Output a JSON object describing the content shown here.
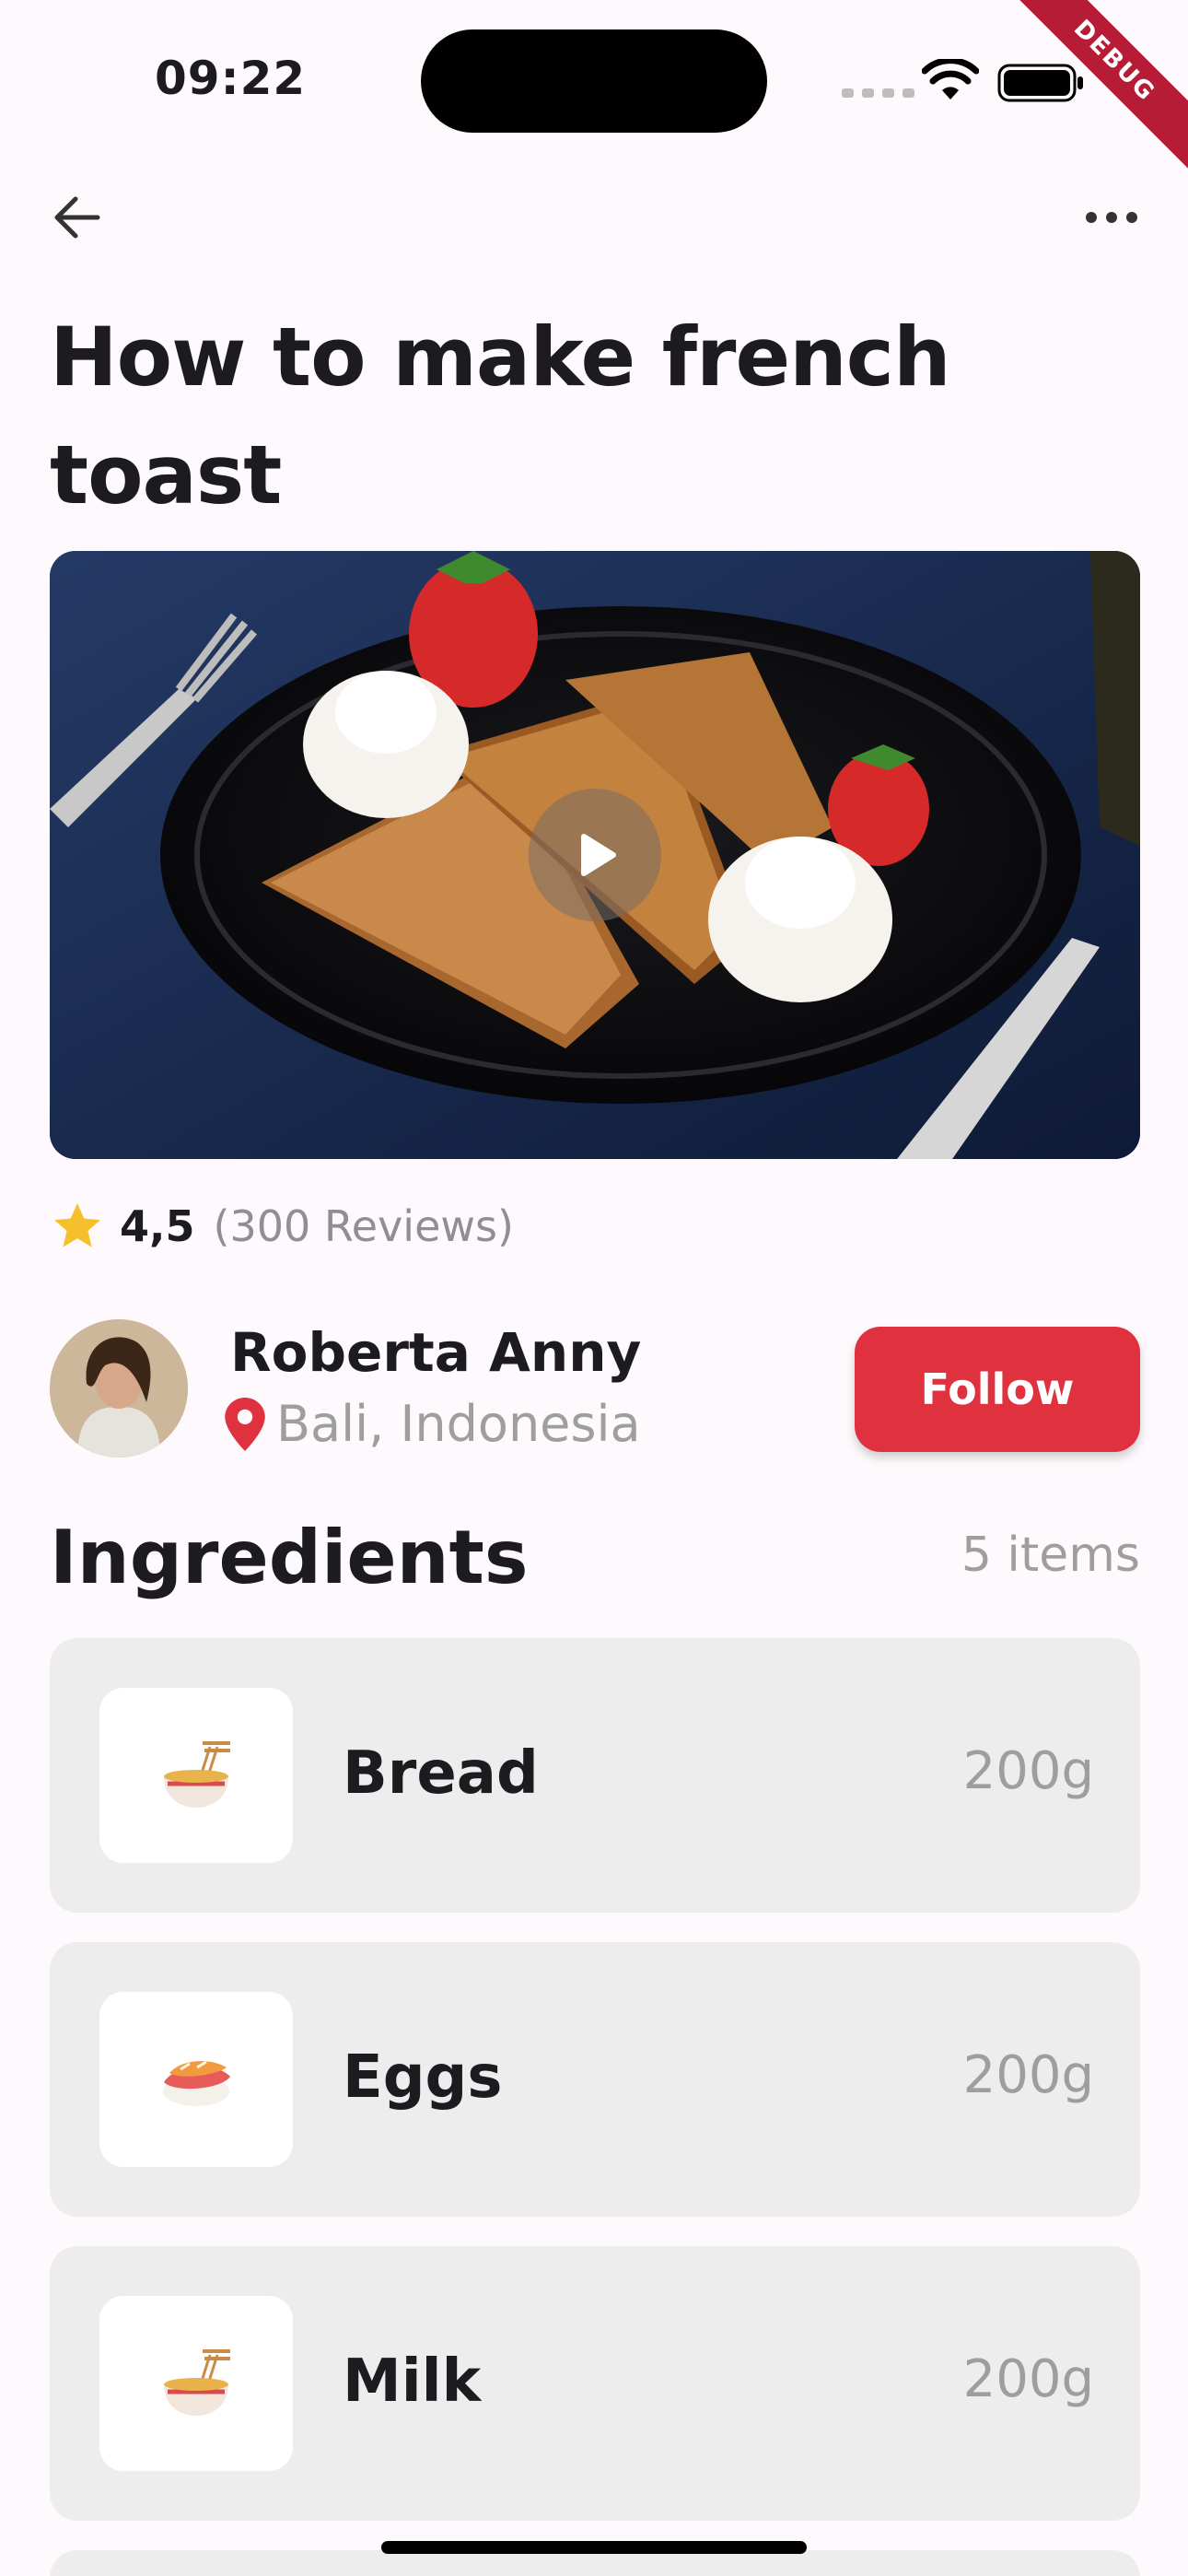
{
  "status_bar": {
    "time": "09:22",
    "debug_label": "DEBUG"
  },
  "header": {
    "back_icon": "arrow-left-icon",
    "more_icon": "more-horizontal-icon"
  },
  "recipe": {
    "title": "How to make french toast",
    "video_icon": "play-icon"
  },
  "rating": {
    "value": "4,5",
    "reviews": "(300 Reviews)",
    "star_color": "#f6c02c"
  },
  "author": {
    "name": "Roberta Anny",
    "location": "Bali, Indonesia",
    "follow_label": "Follow",
    "accent_color": "#e0313f"
  },
  "ingredients": {
    "title": "Ingredients",
    "count": "5 items",
    "items": [
      {
        "name": "Bread",
        "qty": "200g",
        "icon": "noodle-bowl-icon"
      },
      {
        "name": "Eggs",
        "qty": "200g",
        "icon": "sushi-icon"
      },
      {
        "name": "Milk",
        "qty": "200g",
        "icon": "noodle-bowl-icon"
      }
    ]
  }
}
